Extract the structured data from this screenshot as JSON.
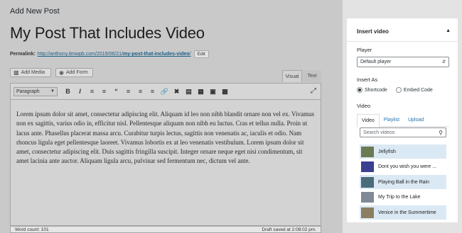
{
  "editor": {
    "page_heading": "Add New Post",
    "post_title": "My Post That Includes Video",
    "permalink_label": "Permalink:",
    "permalink_url_base": "http://anthony.itmwpb.com/2019/06/21/",
    "permalink_slug": "my-post-that-includes-video",
    "permalink_trailing": "/",
    "edit_label": "Edit",
    "add_media_label": "Add Media",
    "add_form_label": "Add Form",
    "tab_visual": "Visual",
    "tab_text": "Text",
    "format_select": "Paragraph",
    "content": "Lorem ipsum dolor sit amet, consectetur adipiscing elit. Aliquam id leo non nibh blandit ornare non vel ex. Vivamus non ex sagittis, varius odio in, efficitur nisl. Pellentesque aliquam non nibh eu luctus. Cras et tellus nulla. Proin ut lacus ante. Phasellus placerat massa arcu. Curabitur turpis lectus, sagittis non venenatis ac, iaculis et odio. Nam rhoncus ligula eget pellentesque laoreet. Vivamus lobortis ex at leo venenatis vestibulum. Lorem ipsum dolor sit amet, consectetur adipiscing elit. Duis sagittis fringilla suscipit. Integer ornare neque eget nisi condimentum, sit amet lacinia ante auctor. Aliquam ligula arcu, pulvinar sed fermentum nec, dictum vel ante.",
    "word_count": "Word count: 101",
    "draft_saved": "Draft saved at 2:08:02 pm."
  },
  "toolbar_icons": [
    "bold-icon",
    "italic-icon",
    "bulleted-list-icon",
    "numbered-list-icon",
    "blockquote-icon",
    "align-left-icon",
    "align-center-icon",
    "align-right-icon",
    "link-icon",
    "unlink-icon",
    "read-more-icon",
    "table-icon",
    "image-icon",
    "video-icon"
  ],
  "sidebar": {
    "panel_title": "Insert video",
    "player_label": "Player",
    "player_value": "Default player",
    "insert_as_label": "Insert As",
    "opt_shortcode": "Shortcode",
    "opt_embed": "Embed Code",
    "video_label": "Video",
    "tabs": [
      "Video",
      "Playlist",
      "Upload"
    ],
    "search_placeholder": "Search videos",
    "videos": [
      {
        "title": "Jellyfish",
        "thumb_color": "#6b7a52"
      },
      {
        "title": "Dont you wish you were ...",
        "thumb_color": "#3b3f8f"
      },
      {
        "title": "Playing Ball in the Rain",
        "thumb_color": "#4a6b7a"
      },
      {
        "title": "My Trip to the Lake",
        "thumb_color": "#7f8a96"
      },
      {
        "title": "Venice in the Summertime",
        "thumb_color": "#8a7e63"
      }
    ]
  },
  "colors": {
    "link": "#2271b1",
    "selected_row": "#dbe9f4",
    "page_overlay": "#c9c9c9"
  }
}
